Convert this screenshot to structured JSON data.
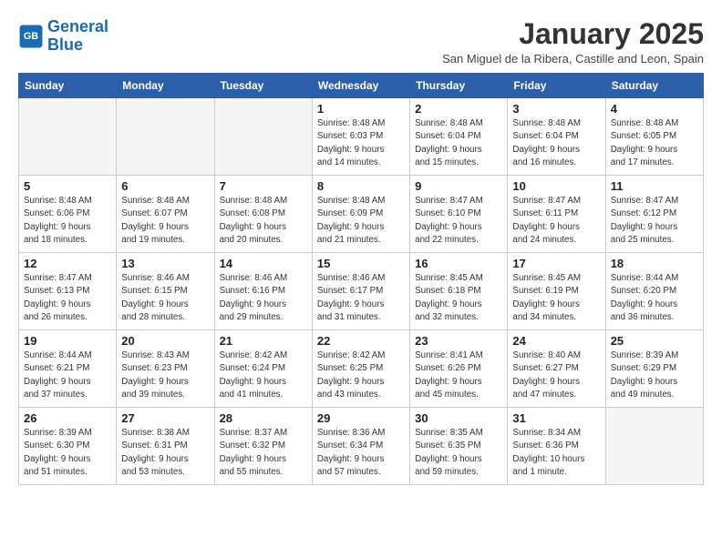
{
  "logo": {
    "line1": "General",
    "line2": "Blue"
  },
  "title": "January 2025",
  "subtitle": "San Miguel de la Ribera, Castille and Leon, Spain",
  "weekdays": [
    "Sunday",
    "Monday",
    "Tuesday",
    "Wednesday",
    "Thursday",
    "Friday",
    "Saturday"
  ],
  "weeks": [
    [
      {
        "day": "",
        "info": ""
      },
      {
        "day": "",
        "info": ""
      },
      {
        "day": "",
        "info": ""
      },
      {
        "day": "1",
        "info": "Sunrise: 8:48 AM\nSunset: 6:03 PM\nDaylight: 9 hours\nand 14 minutes."
      },
      {
        "day": "2",
        "info": "Sunrise: 8:48 AM\nSunset: 6:04 PM\nDaylight: 9 hours\nand 15 minutes."
      },
      {
        "day": "3",
        "info": "Sunrise: 8:48 AM\nSunset: 6:04 PM\nDaylight: 9 hours\nand 16 minutes."
      },
      {
        "day": "4",
        "info": "Sunrise: 8:48 AM\nSunset: 6:05 PM\nDaylight: 9 hours\nand 17 minutes."
      }
    ],
    [
      {
        "day": "5",
        "info": "Sunrise: 8:48 AM\nSunset: 6:06 PM\nDaylight: 9 hours\nand 18 minutes."
      },
      {
        "day": "6",
        "info": "Sunrise: 8:48 AM\nSunset: 6:07 PM\nDaylight: 9 hours\nand 19 minutes."
      },
      {
        "day": "7",
        "info": "Sunrise: 8:48 AM\nSunset: 6:08 PM\nDaylight: 9 hours\nand 20 minutes."
      },
      {
        "day": "8",
        "info": "Sunrise: 8:48 AM\nSunset: 6:09 PM\nDaylight: 9 hours\nand 21 minutes."
      },
      {
        "day": "9",
        "info": "Sunrise: 8:47 AM\nSunset: 6:10 PM\nDaylight: 9 hours\nand 22 minutes."
      },
      {
        "day": "10",
        "info": "Sunrise: 8:47 AM\nSunset: 6:11 PM\nDaylight: 9 hours\nand 24 minutes."
      },
      {
        "day": "11",
        "info": "Sunrise: 8:47 AM\nSunset: 6:12 PM\nDaylight: 9 hours\nand 25 minutes."
      }
    ],
    [
      {
        "day": "12",
        "info": "Sunrise: 8:47 AM\nSunset: 6:13 PM\nDaylight: 9 hours\nand 26 minutes."
      },
      {
        "day": "13",
        "info": "Sunrise: 8:46 AM\nSunset: 6:15 PM\nDaylight: 9 hours\nand 28 minutes."
      },
      {
        "day": "14",
        "info": "Sunrise: 8:46 AM\nSunset: 6:16 PM\nDaylight: 9 hours\nand 29 minutes."
      },
      {
        "day": "15",
        "info": "Sunrise: 8:46 AM\nSunset: 6:17 PM\nDaylight: 9 hours\nand 31 minutes."
      },
      {
        "day": "16",
        "info": "Sunrise: 8:45 AM\nSunset: 6:18 PM\nDaylight: 9 hours\nand 32 minutes."
      },
      {
        "day": "17",
        "info": "Sunrise: 8:45 AM\nSunset: 6:19 PM\nDaylight: 9 hours\nand 34 minutes."
      },
      {
        "day": "18",
        "info": "Sunrise: 8:44 AM\nSunset: 6:20 PM\nDaylight: 9 hours\nand 36 minutes."
      }
    ],
    [
      {
        "day": "19",
        "info": "Sunrise: 8:44 AM\nSunset: 6:21 PM\nDaylight: 9 hours\nand 37 minutes."
      },
      {
        "day": "20",
        "info": "Sunrise: 8:43 AM\nSunset: 6:23 PM\nDaylight: 9 hours\nand 39 minutes."
      },
      {
        "day": "21",
        "info": "Sunrise: 8:42 AM\nSunset: 6:24 PM\nDaylight: 9 hours\nand 41 minutes."
      },
      {
        "day": "22",
        "info": "Sunrise: 8:42 AM\nSunset: 6:25 PM\nDaylight: 9 hours\nand 43 minutes."
      },
      {
        "day": "23",
        "info": "Sunrise: 8:41 AM\nSunset: 6:26 PM\nDaylight: 9 hours\nand 45 minutes."
      },
      {
        "day": "24",
        "info": "Sunrise: 8:40 AM\nSunset: 6:27 PM\nDaylight: 9 hours\nand 47 minutes."
      },
      {
        "day": "25",
        "info": "Sunrise: 8:39 AM\nSunset: 6:29 PM\nDaylight: 9 hours\nand 49 minutes."
      }
    ],
    [
      {
        "day": "26",
        "info": "Sunrise: 8:39 AM\nSunset: 6:30 PM\nDaylight: 9 hours\nand 51 minutes."
      },
      {
        "day": "27",
        "info": "Sunrise: 8:38 AM\nSunset: 6:31 PM\nDaylight: 9 hours\nand 53 minutes."
      },
      {
        "day": "28",
        "info": "Sunrise: 8:37 AM\nSunset: 6:32 PM\nDaylight: 9 hours\nand 55 minutes."
      },
      {
        "day": "29",
        "info": "Sunrise: 8:36 AM\nSunset: 6:34 PM\nDaylight: 9 hours\nand 57 minutes."
      },
      {
        "day": "30",
        "info": "Sunrise: 8:35 AM\nSunset: 6:35 PM\nDaylight: 9 hours\nand 59 minutes."
      },
      {
        "day": "31",
        "info": "Sunrise: 8:34 AM\nSunset: 6:36 PM\nDaylight: 10 hours\nand 1 minute."
      },
      {
        "day": "",
        "info": ""
      }
    ]
  ]
}
